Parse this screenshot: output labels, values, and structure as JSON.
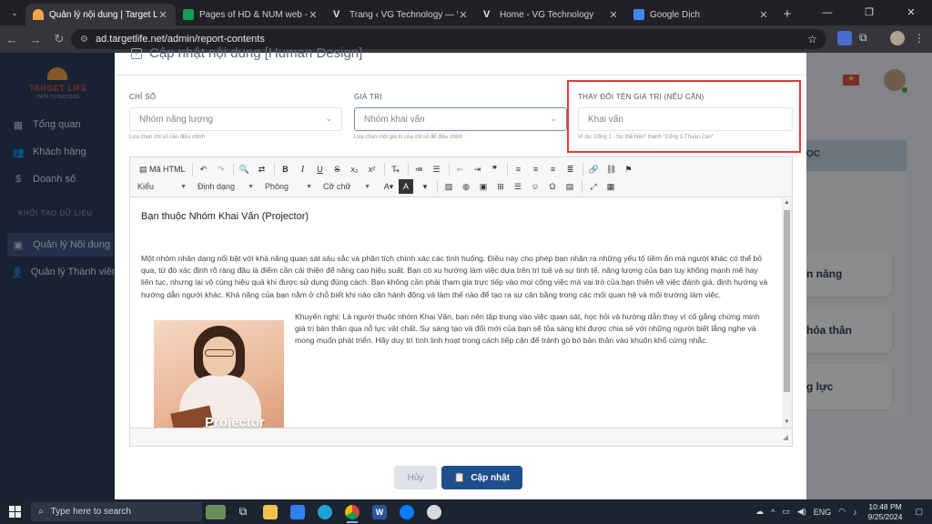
{
  "browser": {
    "tabs": [
      {
        "title": "Quản lý nội dung | Target Life",
        "active": true,
        "favicon_color": "#f0a34a"
      },
      {
        "title": "Pages of HD & NUM web - Goo",
        "active": false,
        "favicon_color": "#0f9d58"
      },
      {
        "title": "Trang ‹ VG Technology — Word",
        "active": false,
        "favicon_color": "#e8eaed"
      },
      {
        "title": "Home - VG Technology",
        "active": false,
        "favicon_color": "#e8eaed"
      },
      {
        "title": "Google Dịch",
        "active": false,
        "favicon_color": "#4285f4"
      }
    ],
    "new_tab": "+",
    "url": "ad.targetlife.net/admin/report-contents",
    "window_controls": [
      "—",
      "❐",
      "✕"
    ]
  },
  "app": {
    "logo": {
      "name": "TARGET LIFE",
      "tagline": "PATH TO SUCCESS"
    },
    "sidebar": {
      "items": [
        {
          "label": "Tổng quan",
          "icon": "grid-icon",
          "glyph": "▦"
        },
        {
          "label": "Khách hàng",
          "icon": "users-icon",
          "glyph": "👥"
        },
        {
          "label": "Doanh số",
          "icon": "dollar-icon",
          "glyph": "$"
        }
      ],
      "section": "KHỞI TẠO DỮ LIỆU",
      "data_items": [
        {
          "label": "Quản lý Nội dung",
          "icon": "content-icon",
          "glyph": "▣",
          "active": true
        },
        {
          "label": "Quản lý Thành viên",
          "icon": "members-icon",
          "glyph": "👤",
          "active": false
        }
      ]
    },
    "background_cards": [
      {
        "label": "n năng"
      },
      {
        "label": "hóa thân"
      },
      {
        "label": "g lực"
      }
    ],
    "background_panel_title": "ỌC"
  },
  "modal": {
    "title": "Cập nhật nội dung [Human Design]",
    "fields": {
      "chi_so": {
        "label": "CHỈ SỐ",
        "value": "Nhóm năng lượng",
        "help": "Lựa chọn chỉ số cần điều chỉnh"
      },
      "gia_tri": {
        "label": "GIÁ TRỊ",
        "value": "Nhóm khai vấn",
        "help": "Lựa chọn một giá trị của chỉ số để điều chỉnh"
      },
      "ten_gia_tri": {
        "label": "THAY ĐỔI TÊN GIÁ TRỊ (NẾU CẦN)",
        "placeholder": "Khai vấn",
        "help": "Ví dụ: Cổng 1 - Sự thể hiện\" thành \"Cổng 1-Thuần Càn\""
      }
    },
    "editor": {
      "toolbar_row1": [
        "Mã HTML"
      ],
      "combos": [
        "Kiểu",
        "Định dạng",
        "Phông",
        "Cỡ chữ"
      ],
      "heading": "Bạn thuộc Nhóm Khai Vấn (Projector)",
      "paragraph1": "Một nhóm nhân dạng nổi bật với khả năng quan sát sâu sắc và phân tích chính xác các tình huống. Điều này cho phép bạn nhận ra những yếu tố tiềm ẩn mà người khác có thể bỏ qua, từ đó xác định rõ ràng đâu là điểm cần cải thiện để nâng cao hiệu suất. Bạn có xu hướng làm việc dựa trên trí tuệ và sự tinh tế, năng lượng của bạn tuy không mạnh mẽ hay liên tục, nhưng lại vô cùng hiệu quả khi được sử dụng đúng cách. Bạn không cần phải tham gia trực tiếp vào mọi công việc mà vai trò của bạn thiên về việc đánh giá, định hướng và hướng dẫn người khác. Khả năng của bạn nằm ở chỗ biết khi nào cần hành động và làm thế nào để tạo ra sự cân bằng trong các mối quan hệ và môi trường làm việc.",
      "image_caption": "Projector",
      "paragraph2": "Khuyến nghị: Là người thuộc nhóm Khai Vấn, bạn nên tập trung vào việc quan sát, học hỏi và hướng dẫn thay vì cố gắng chứng minh giá trị  bản thân qua nỗ lực vật chất. Sự sáng tạo và đổi mới của bạn sẽ tỏa sáng khi được chia sẻ với những người biết lắng nghe và mong muốn phát triển. Hãy duy trì tính linh hoạt trong cách tiếp cận để tránh gò bó bản thân vào khuôn khổ cứng nhắc."
    },
    "buttons": {
      "cancel": "Hủy",
      "save": "Cập nhật"
    }
  },
  "taskbar": {
    "search_placeholder": "Type here to search",
    "apps": [
      {
        "name": "landscape-widget-icon",
        "color": "#6a8e5a"
      },
      {
        "name": "task-view-icon",
        "color": "#e8eaed"
      },
      {
        "name": "file-explorer-icon",
        "color": "#f2c14e"
      },
      {
        "name": "vscode-icon",
        "color": "#2f80ed"
      },
      {
        "name": "edge-icon",
        "color": "#1fa2d6"
      },
      {
        "name": "chrome-icon",
        "color": "#e0e0e0",
        "active": true
      },
      {
        "name": "word-icon",
        "color": "#2b579a"
      },
      {
        "name": "zalo-icon",
        "color": "#0a7cff"
      },
      {
        "name": "paint-icon",
        "color": "#d9d9d9"
      }
    ],
    "lang": "ENG",
    "time": "10:48 PM",
    "date": "9/25/2024"
  }
}
